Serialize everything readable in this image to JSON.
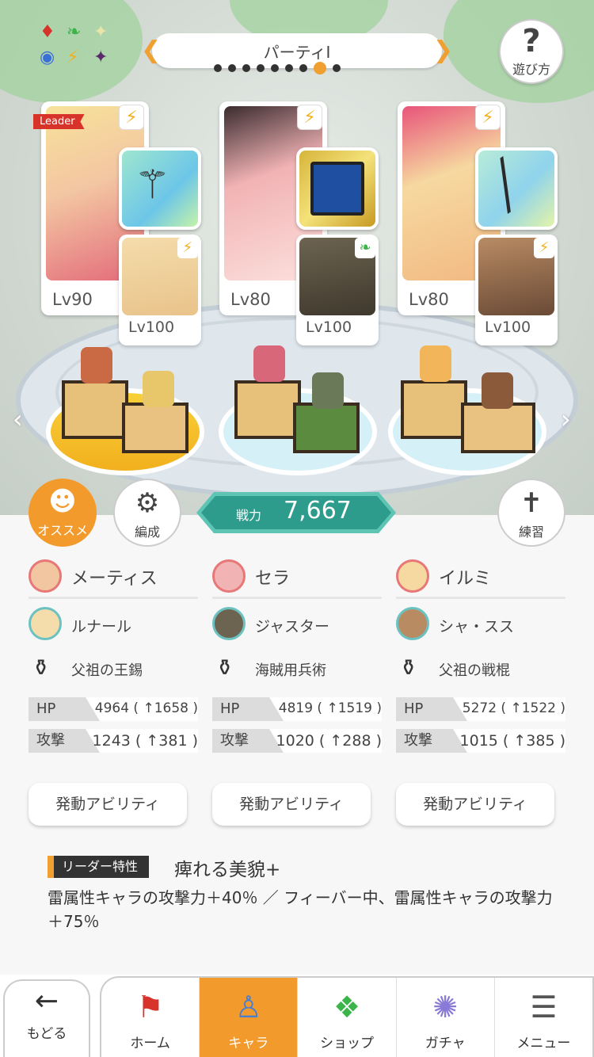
{
  "header": {
    "title": "パーティI",
    "page_count": 9,
    "current_page": 8,
    "help_label": "遊び方"
  },
  "party": [
    {
      "name": "メーティス",
      "level": "Lv90",
      "leader_label": "Leader",
      "sub_name": "ルナール",
      "sub_level": "Lv100",
      "weapon": "父祖の王錫",
      "hp": "4964 ( ↑1658 )",
      "atk": "1243 ( ↑381 )",
      "ability": "発動アビリティ",
      "portrait_color": "#f3c6a2",
      "sub_color": "#f4dcab",
      "weapon_color": "#9fe6cf"
    },
    {
      "name": "セラ",
      "level": "Lv80",
      "sub_name": "ジャスター",
      "sub_level": "Lv100",
      "weapon": "海賊用兵術",
      "hp": "4819 ( ↑1519 )",
      "atk": "1020 ( ↑288 )",
      "ability": "発動アビリティ",
      "portrait_color": "#f2b3b5",
      "sub_color": "#6c6450",
      "weapon_color": "#e8c35a"
    },
    {
      "name": "イルミ",
      "level": "Lv80",
      "sub_name": "シャ・スス",
      "sub_level": "Lv100",
      "weapon": "父祖の戦棍",
      "hp": "5272 ( ↑1522 )",
      "atk": "1015 ( ↑385 )",
      "ability": "発動アビリティ",
      "portrait_color": "#f6d9a0",
      "sub_color": "#b88b63",
      "weapon_color": "#b8ecd8"
    }
  ],
  "stat_labels": {
    "hp": "HP",
    "atk": "攻撃"
  },
  "power": {
    "label": "戦力",
    "value": "7,667"
  },
  "actions": {
    "recommend": "オススメ",
    "formation": "編成",
    "practice": "練習"
  },
  "leader_trait": {
    "tag": "リーダー特性",
    "name": "痺れる美貌+",
    "description": "雷属性キャラの攻撃力＋40％ ／ フィーバー中、雷属性キャラの攻撃力＋75％"
  },
  "tabs": {
    "back": "もどる",
    "items": [
      {
        "label": "ホーム",
        "icon": "home-icon"
      },
      {
        "label": "キャラ",
        "icon": "chara-icon",
        "active": true
      },
      {
        "label": "ショップ",
        "icon": "shop-icon"
      },
      {
        "label": "ガチャ",
        "icon": "gacha-icon"
      },
      {
        "label": "メニュー",
        "icon": "menu-icon"
      }
    ]
  },
  "colors": {
    "accent": "#f39a2c",
    "teal": "#2e9c8c",
    "leader_red": "#d8332b"
  }
}
